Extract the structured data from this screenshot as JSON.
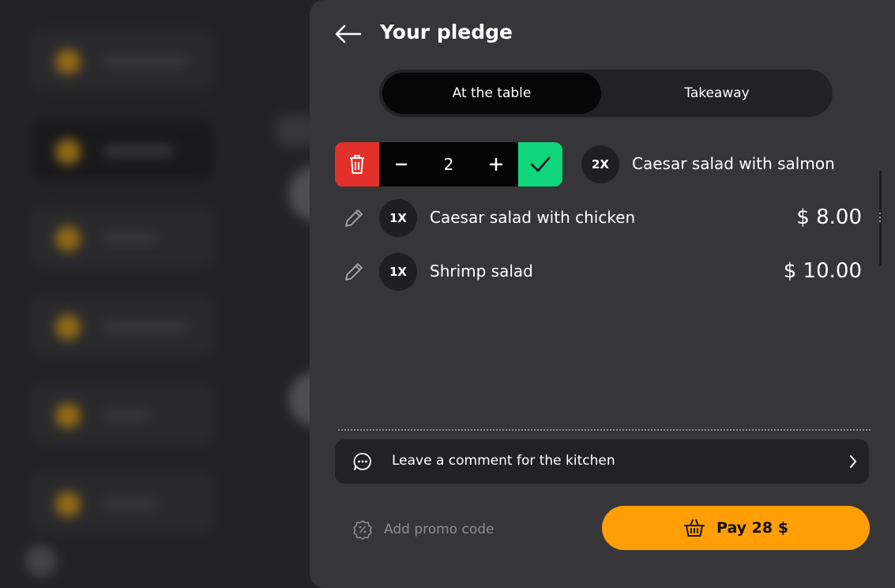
{
  "panel": {
    "title": "Your pledge"
  },
  "order_type": {
    "options": [
      "At the table",
      "Takeaway"
    ],
    "selected": "At the table"
  },
  "editing_item": {
    "quantity": "2",
    "badge": "2X",
    "name": "Caesar salad with salmon"
  },
  "items": [
    {
      "badge": "1X",
      "name": "Caesar salad with chicken",
      "price": "$ 8.00"
    },
    {
      "badge": "1X",
      "name": "Shrimp salad",
      "price": "$ 10.00"
    }
  ],
  "comment": {
    "label": "Leave a comment for the kitchen"
  },
  "promo": {
    "label": "Add promo code"
  },
  "pay": {
    "label": "Pay 28 $"
  },
  "colors": {
    "accent": "#ff9f05",
    "delete": "#e4302b",
    "confirm": "#0fd67a",
    "panel_bg": "#363638"
  },
  "icons": [
    "back-arrow-icon",
    "trash-icon",
    "minus-icon",
    "plus-icon",
    "checkmark-icon",
    "pencil-icon",
    "chat-bubble-icon",
    "chevron-right-icon",
    "discount-badge-icon",
    "basket-icon"
  ]
}
